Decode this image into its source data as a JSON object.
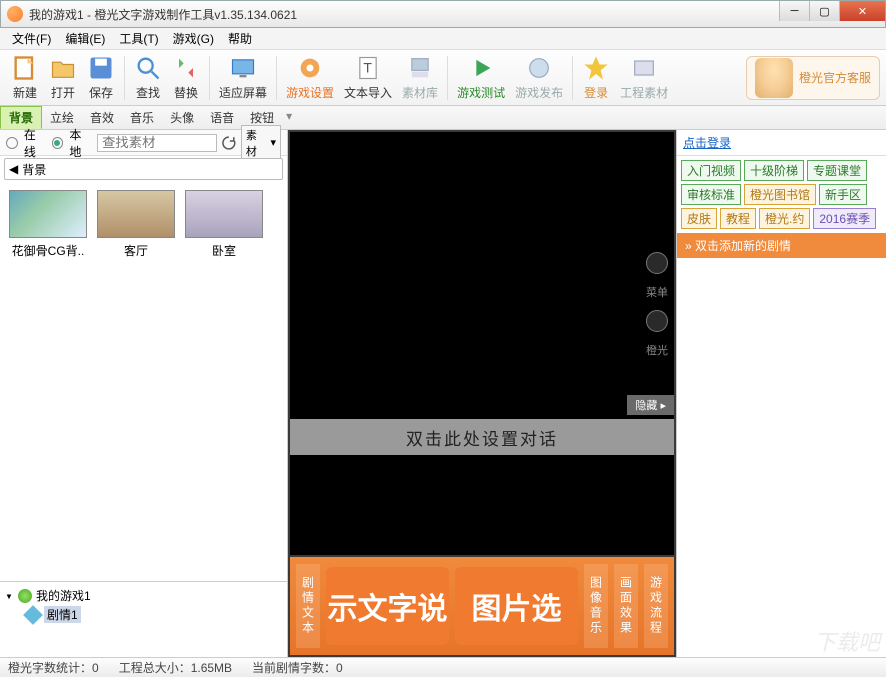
{
  "title": "我的游戏1  - 橙光文字游戏制作工具v1.35.134.0621",
  "menubar": [
    "文件(F)",
    "编辑(E)",
    "工具(T)",
    "游戏(G)",
    "帮助"
  ],
  "toolbar": [
    {
      "k": "new",
      "label": "新建"
    },
    {
      "k": "open",
      "label": "打开"
    },
    {
      "k": "save",
      "label": "保存"
    },
    {
      "k": "find",
      "label": "查找"
    },
    {
      "k": "replace",
      "label": "替换"
    },
    {
      "k": "fit",
      "label": "适应屏幕"
    },
    {
      "k": "gameset",
      "label": "游戏设置",
      "accent": true
    },
    {
      "k": "textimport",
      "label": "文本导入"
    },
    {
      "k": "assets",
      "label": "素材库",
      "dim": true
    },
    {
      "k": "gametest",
      "label": "游戏测试",
      "accent": true
    },
    {
      "k": "publish",
      "label": "游戏发布",
      "dim": true
    },
    {
      "k": "login",
      "label": "登录",
      "accent": true
    },
    {
      "k": "engmat",
      "label": "工程素材",
      "dim": true
    }
  ],
  "cs_label": "橙光官方客服",
  "tabs": [
    "背景",
    "立绘",
    "音效",
    "音乐",
    "头像",
    "语音",
    "按钮"
  ],
  "active_tab_index": 0,
  "search": {
    "online": "在线",
    "local": "本地",
    "placeholder": "查找素材",
    "dropdown": "素材"
  },
  "crumb": "背景",
  "thumbs": [
    {
      "cap": "花御骨CG背..",
      "cls": "bg1"
    },
    {
      "cap": "客厅",
      "cls": "bg2"
    },
    {
      "cap": "卧室",
      "cls": "bg3"
    }
  ],
  "tree": {
    "root": "我的游戏1",
    "child": "剧情1"
  },
  "preview": {
    "side_menu": "菜单",
    "side_cg": "橙光",
    "hide": "隐藏",
    "dialog": "双击此处设置对话",
    "cols": [
      "剧情文本",
      "图像音乐",
      "画面效果",
      "游戏流程"
    ],
    "btn1": "示文字说",
    "btn2": "图片选"
  },
  "right": {
    "login": "点击登录",
    "tags": [
      {
        "t": "入门视频",
        "c": "green"
      },
      {
        "t": "十级阶梯",
        "c": "green"
      },
      {
        "t": "专题课堂",
        "c": "green"
      },
      {
        "t": "审核标准",
        "c": "green"
      },
      {
        "t": "橙光图书馆",
        "c": "yellow"
      },
      {
        "t": "新手区",
        "c": "green"
      },
      {
        "t": "皮肤",
        "c": "yellow"
      },
      {
        "t": "教程",
        "c": "yellow"
      },
      {
        "t": "橙光.约",
        "c": "yellow"
      },
      {
        "t": "2016赛季",
        "c": "purple"
      }
    ],
    "add_plot": "» 双击添加新的剧情"
  },
  "status": {
    "a": "橙光字数统计：0",
    "b": "工程总大小：1.65MB",
    "c": "当前剧情字数：0"
  },
  "watermark": "下载吧"
}
